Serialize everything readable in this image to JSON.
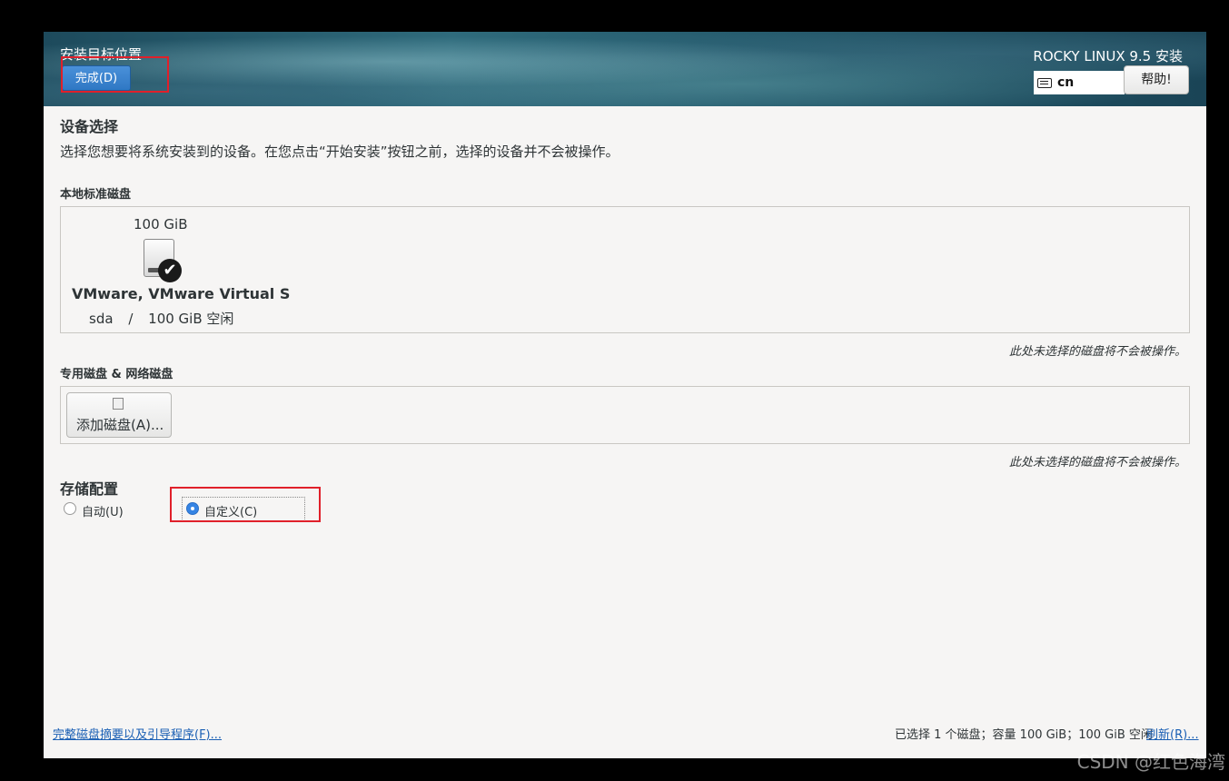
{
  "header": {
    "title": "安装目标位置",
    "done_label": "完成(D)",
    "product": "ROCKY LINUX 9.5 安装",
    "keyboard_layout": "cn",
    "help_label": "帮助!"
  },
  "device_selection": {
    "heading": "设备选择",
    "description": "选择您想要将系统安装到的设备。在您点击“开始安装”按钮之前，选择的设备并不会被操作。"
  },
  "local_disks": {
    "label": "本地标准磁盘",
    "disks": [
      {
        "size": "100 GiB",
        "name": "VMware, VMware Virtual S",
        "device": "sda",
        "separator": "/",
        "free": "100 GiB 空闲",
        "selected": true
      }
    ],
    "note": "此处未选择的磁盘将不会被操作。"
  },
  "special_disks": {
    "label": "专用磁盘 & 网络磁盘",
    "add_label": "添加磁盘(A)...",
    "note": "此处未选择的磁盘将不会被操作。"
  },
  "storage_config": {
    "heading": "存储配置",
    "options": [
      {
        "label": "自动(U)",
        "selected": false
      },
      {
        "label": "自定义(C)",
        "selected": true
      }
    ]
  },
  "footer": {
    "summary_link": "完整磁盘摘要以及引导程序(F)...",
    "status": "已选择 1 个磁盘；容量 100 GiB；100 GiB 空闲",
    "refresh_link": "刷新(R)..."
  },
  "watermark": "CSDN @红色海湾",
  "colors": {
    "accent": "#3584e4",
    "annotation_red": "#e0202a",
    "link": "#1a5fb4"
  }
}
